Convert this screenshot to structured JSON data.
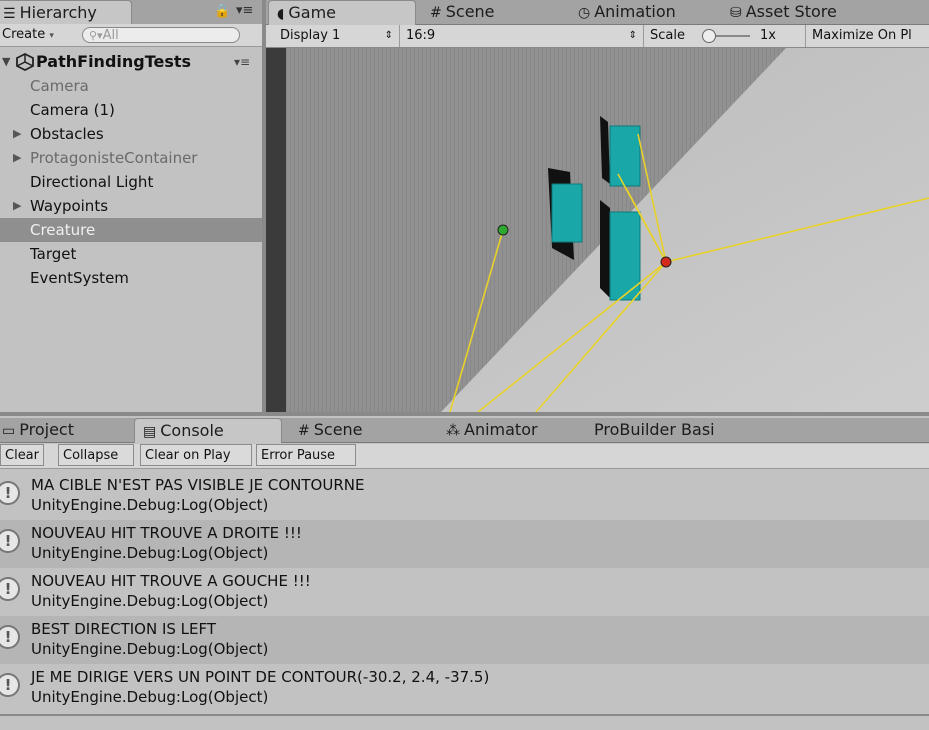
{
  "hierarchy": {
    "tab_label": "Hierarchy",
    "create_label": "Create",
    "search_placeholder": "All",
    "scene_name": "PathFindingTests",
    "items": [
      {
        "label": "Camera",
        "state": "dim"
      },
      {
        "label": "Camera (1)",
        "state": "normal"
      },
      {
        "label": "Obstacles",
        "state": "normal",
        "expandable": true
      },
      {
        "label": "ProtagonisteContainer",
        "state": "dim",
        "expandable": true
      },
      {
        "label": "Directional Light",
        "state": "normal"
      },
      {
        "label": "Waypoints",
        "state": "normal",
        "expandable": true
      },
      {
        "label": "Creature",
        "state": "selected"
      },
      {
        "label": "Target",
        "state": "normal"
      },
      {
        "label": "EventSystem",
        "state": "normal"
      }
    ]
  },
  "top_tabs": {
    "game": "Game",
    "scene": "Scene",
    "animation": "Animation",
    "asset_store": "Asset Store"
  },
  "game_toolbar": {
    "display": "Display 1",
    "aspect": "16:9",
    "scale_label": "Scale",
    "scale_value": "1x",
    "maximize": "Maximize On Pl"
  },
  "bottom_tabs": {
    "project": "Project",
    "console": "Console",
    "scene": "Scene",
    "animator": "Animator",
    "probuilder": "ProBuilder Basi"
  },
  "console_buttons": {
    "clear": "Clear",
    "collapse": "Collapse",
    "clear_on_play": "Clear on Play",
    "error_pause": "Error Pause"
  },
  "console_logs": [
    {
      "message": "MA CIBLE N'EST PAS VISIBLE JE CONTOURNE",
      "source": "UnityEngine.Debug:Log(Object)"
    },
    {
      "message": "NOUVEAU HIT TROUVE A DROITE !!!",
      "source": "UnityEngine.Debug:Log(Object)"
    },
    {
      "message": "NOUVEAU HIT TROUVE A GOUCHE !!!",
      "source": "UnityEngine.Debug:Log(Object)"
    },
    {
      "message": "BEST DIRECTION IS LEFT",
      "source": "UnityEngine.Debug:Log(Object)"
    },
    {
      "message": "JE ME DIRIGE VERS UN POINT DE CONTOUR(-30.2, 2.4, -37.5)",
      "source": "UnityEngine.Debug:Log(Object)"
    }
  ],
  "colors": {
    "obstacle": "#1aa7a7",
    "ray": "#e8d22a",
    "agent": "#d42a1a",
    "target": "#2ea82e"
  }
}
